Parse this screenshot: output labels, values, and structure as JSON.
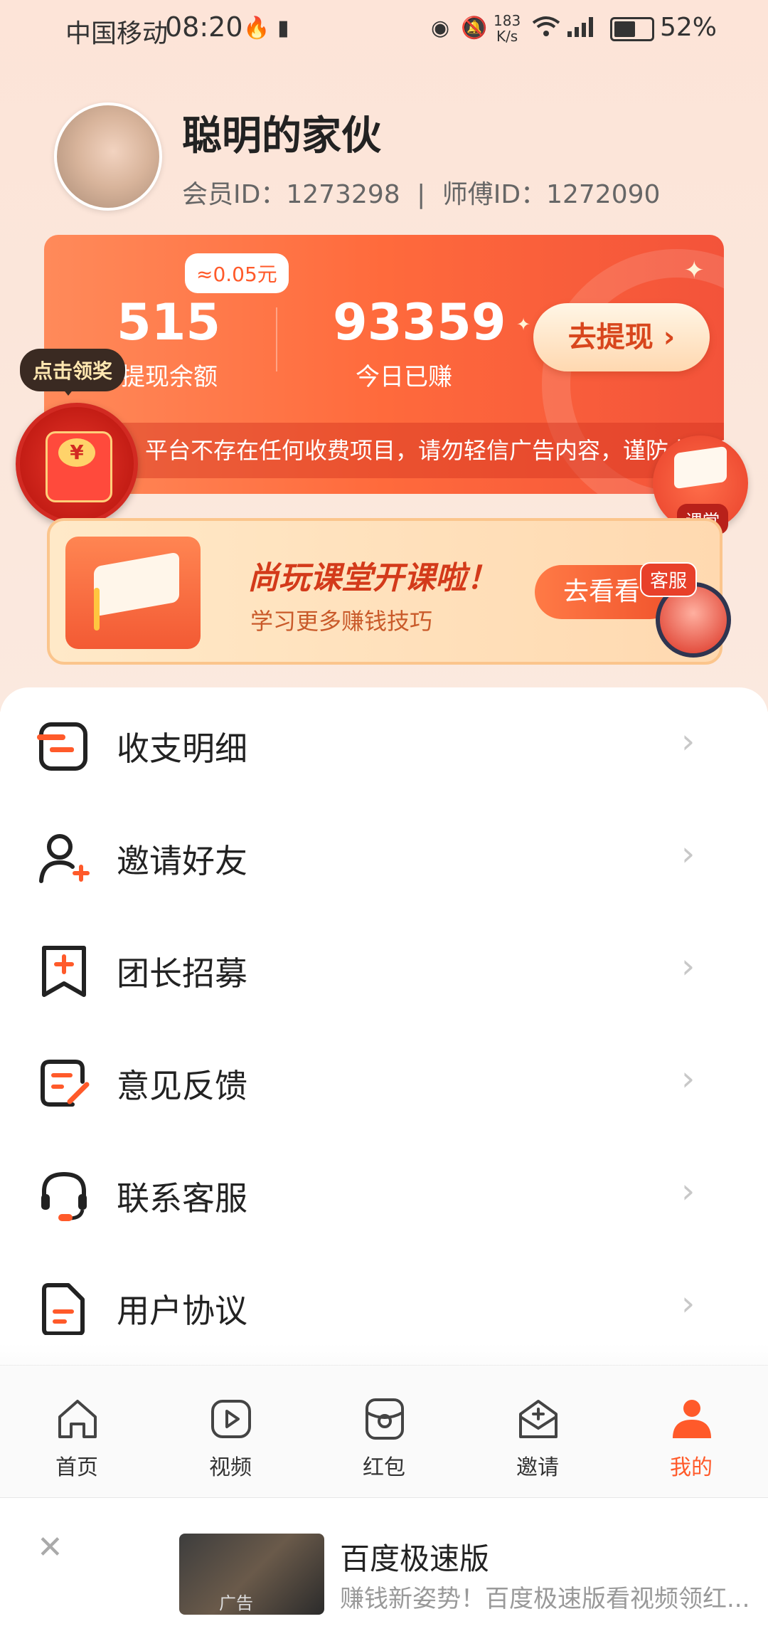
{
  "status_bar": {
    "carrier": "中国移动",
    "time": "08:20",
    "net_speed": "183",
    "net_unit": "K/s",
    "battery_pct": "52%",
    "battery_level": 0.52
  },
  "profile": {
    "nickname": "聪明的家伙",
    "member_id_label": "会员ID：",
    "member_id": "1273298",
    "separator": "|",
    "master_id_label": "师傅ID：",
    "master_id": "1272090"
  },
  "wallet": {
    "approx_value": "≈0.05元",
    "balance": "515",
    "balance_label": "提现余额",
    "today_earned": "93359",
    "today_earned_label": "今日已赚",
    "withdraw_button": "去提现 ›",
    "notice": "平台不存在任何收费项目，请勿轻信广告内容，谨防上当受骗"
  },
  "floating": {
    "claim_tip": "点击领奖",
    "classroom_label": "课堂",
    "service_label": "客服"
  },
  "course_banner": {
    "title": "尚玩课堂开课啦！",
    "subtitle": "学习更多赚钱技巧",
    "button": "去看看"
  },
  "menu": {
    "items": [
      {
        "label": "收支明细",
        "icon": "ledger-icon"
      },
      {
        "label": "邀请好友",
        "icon": "invite-user-icon"
      },
      {
        "label": "团长招募",
        "icon": "bookmark-plus-icon"
      },
      {
        "label": "意见反馈",
        "icon": "feedback-edit-icon"
      },
      {
        "label": "联系客服",
        "icon": "headset-icon"
      },
      {
        "label": "用户协议",
        "icon": "document-icon"
      }
    ]
  },
  "bottom_nav": {
    "items": [
      {
        "label": "首页",
        "icon": "home-icon"
      },
      {
        "label": "视频",
        "icon": "video-icon"
      },
      {
        "label": "红包",
        "icon": "red-packet-icon"
      },
      {
        "label": "邀请",
        "icon": "invite-icon"
      },
      {
        "label": "我的",
        "icon": "profile-icon"
      }
    ],
    "active_index": 4
  },
  "ad": {
    "tag": "广告",
    "app_name": "百度极速版",
    "description": "赚钱新姿势！百度极速版看视频领红..."
  },
  "colors": {
    "accent": "#ff5a2a",
    "card_start": "#ff8a5a",
    "card_end": "#f3533a",
    "icon_dark": "#222222"
  }
}
